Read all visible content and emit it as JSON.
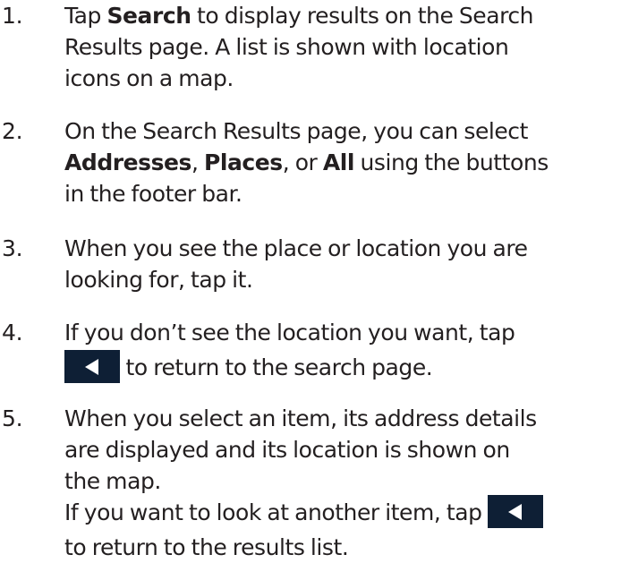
{
  "steps": [
    {
      "number": "1.",
      "lines": [
        [
          "Tap ",
          "Search",
          " to display results on the Search"
        ],
        [
          "Results page. A list is shown with location"
        ],
        [
          "icons on a map."
        ]
      ]
    },
    {
      "number": "2.",
      "lines": [
        [
          "On the Search Results page, you can select"
        ],
        [
          "Addresses",
          ", ",
          "Places",
          ", or ",
          "All",
          " using the buttons"
        ],
        [
          "in  the footer bar."
        ]
      ]
    },
    {
      "number": "3.",
      "lines": [
        [
          "When you see the place or location you are"
        ],
        [
          "looking for, tap it."
        ]
      ]
    },
    {
      "number": "4.",
      "lines": [
        [
          "If you don’t see the location you want, tap"
        ],
        [
          "to return to the search page."
        ]
      ]
    },
    {
      "number": "5.",
      "lines": [
        [
          "When you select an item, its address details"
        ],
        [
          "are displayed and its location is shown on"
        ],
        [
          "the map."
        ],
        [
          "If you want to look at another item, tap"
        ],
        [
          "to return to the results list."
        ]
      ]
    }
  ],
  "icons": {
    "back_button": "back-arrow-icon",
    "back_button_color": "#0e1f35",
    "arrow_color": "#ffffff"
  }
}
